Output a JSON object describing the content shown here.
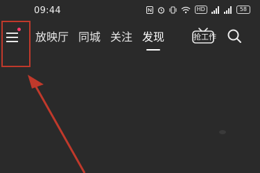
{
  "status_bar": {
    "time": "09:44",
    "icons": [
      "nfc-icon",
      "alarm-icon",
      "vibrate-icon",
      "wifi-icon",
      "hd-icon",
      "signal-icon",
      "signal-icon",
      "battery-icon"
    ],
    "hd_label": "HD",
    "battery_label": "58"
  },
  "nav": {
    "tabs": [
      {
        "label": "放映厅"
      },
      {
        "label": "同城"
      },
      {
        "label": "关注"
      },
      {
        "label": "发现"
      }
    ],
    "active_tab": "发现",
    "tv_icon_label": "抢工作",
    "has_notification_dot": true
  },
  "annotation": {
    "highlight_color": "#c0392b",
    "arrow_color": "#c0392b"
  }
}
